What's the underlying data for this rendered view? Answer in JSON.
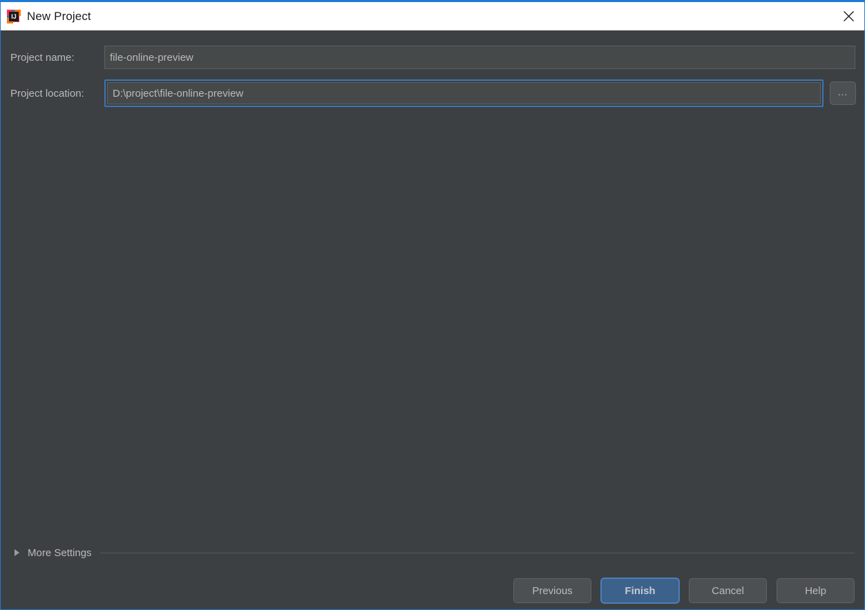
{
  "window": {
    "title": "New Project",
    "app_icon": "intellij-idea-logo-icon",
    "close_icon": "close-icon",
    "accent_color": "#1f7ad4",
    "titlebar_bg": "#ffffff",
    "dialog_bg": "#3c4043"
  },
  "form": {
    "fields": [
      {
        "label": "Project name:",
        "value": "file-online-preview",
        "placeholder": "Project name",
        "focused": false
      },
      {
        "label": "Project location:",
        "value": "D:\\project\\file-online-preview",
        "placeholder": "Project location",
        "focused": true
      }
    ],
    "browse_button_label": "...",
    "browse_button_icon": "ellipsis-icon",
    "input_bg": "#45494a",
    "focus_border_color": "#3d74b8"
  },
  "more_settings": {
    "label": "More Settings",
    "expanded": false,
    "arrow_icon": "chevron-right-icon"
  },
  "buttons": [
    {
      "label": "Previous",
      "name": "previous-button",
      "default": false
    },
    {
      "label": "Finish",
      "name": "finish-button",
      "default": true
    },
    {
      "label": "Cancel",
      "name": "cancel-button",
      "default": false
    },
    {
      "label": "Help",
      "name": "help-button",
      "default": false
    }
  ],
  "button_labels": {
    "previous": "Previous",
    "finish": "Finish",
    "cancel": "Cancel",
    "help": "Help"
  },
  "colors": {
    "default_button_bg": "#3c628c",
    "button_bg": "#4c5052",
    "text": "#bbbbbb"
  }
}
